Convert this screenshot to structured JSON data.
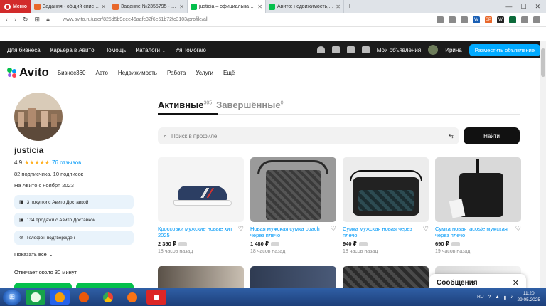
{
  "browser": {
    "menu_label": "Меню",
    "tabs": [
      {
        "title": "Задания - общий список ..."
      },
      {
        "title": "Задание №2355795 - про..."
      },
      {
        "title": "justicia – официальная стр..."
      },
      {
        "title": "Авито: недвижимость, тра..."
      }
    ],
    "url": "www.avito.ru/user/825d5b9eee46aafc32f6e51b72fc3103/profile/all"
  },
  "topbar": {
    "links": [
      "Для бизнеса",
      "Карьера в Авито",
      "Помощь",
      "Каталоги",
      "#яПомогаю"
    ],
    "my_ads": "Мои объявления",
    "user_name": "Ирина",
    "post_button": "Разместить объявление"
  },
  "avito": {
    "logo": "Avito",
    "nav": [
      "Бизнес360",
      "Авто",
      "Недвижимость",
      "Работа",
      "Услуги",
      "Ещё"
    ]
  },
  "profile": {
    "name": "justicia",
    "rating": "4,9",
    "stars": "★★★★★",
    "reviews": "76 отзывов",
    "subscribers": "82 подписчика, 10 подписок",
    "since": "На Авито с ноября 2023",
    "badges": [
      "3 покупки с Авито Доставкой",
      "134 продажи с Авито Доставкой",
      "Телефон подтверждён"
    ],
    "show_all": "Показать все",
    "answer_time": "Отвечает около 30 минут"
  },
  "main": {
    "tab_active": "Активные",
    "tab_active_count": "305",
    "tab_done": "Завершённые",
    "tab_done_count": "0",
    "search_placeholder": "Поиск в профиле",
    "find_button": "Найти",
    "items": [
      {
        "title": "Кроссовки мужские новые хит 2025",
        "price": "2 350 ₽",
        "time": "18 часов назад"
      },
      {
        "title": "Новая мужская сумка coach через плечо",
        "price": "1 480 ₽",
        "time": "18 часов назад"
      },
      {
        "title": "Сумка мужская новая через плечо",
        "price": "940 ₽",
        "time": "18 часов назад"
      },
      {
        "title": "Сумка новая lacoste мужская через плечо",
        "price": "690 ₽",
        "time": "19 часов назад"
      }
    ]
  },
  "messages": {
    "title": "Сообщения"
  },
  "taskbar": {
    "lang": "RU",
    "time": "11:20",
    "date": "29.05.2025"
  }
}
